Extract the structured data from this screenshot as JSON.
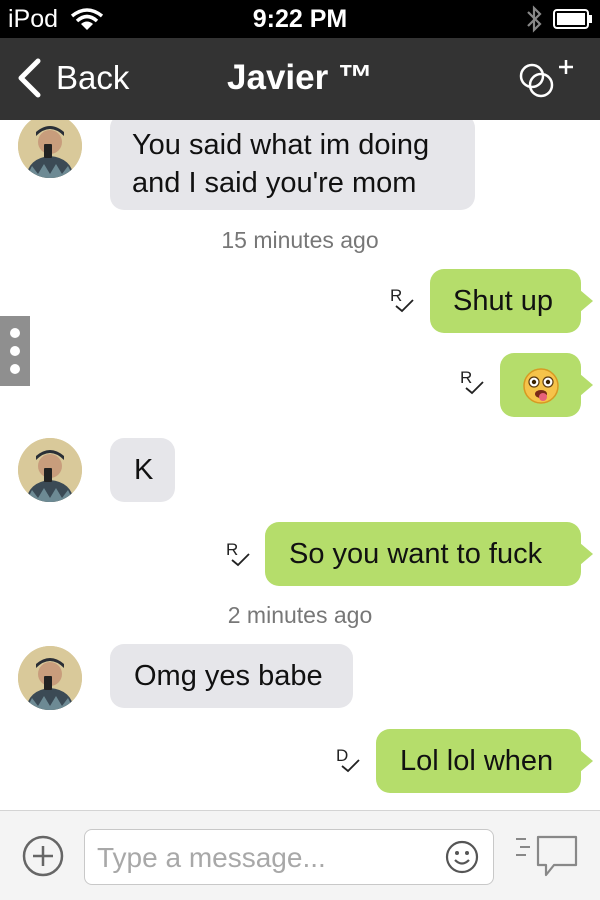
{
  "status_bar": {
    "carrier": "iPod",
    "time": "9:22 PM"
  },
  "nav": {
    "back_label": "Back",
    "title": "Javier ™"
  },
  "messages": [
    {
      "from": "contact",
      "text_lines": [
        "You said what im doing",
        "and I said you're mom"
      ]
    },
    {
      "timestamp": "15 minutes ago"
    },
    {
      "from": "me",
      "text": "Shut up",
      "receipt": "R"
    },
    {
      "from": "me",
      "emoji": "astonished-tongue-emoji",
      "receipt": "R"
    },
    {
      "from": "contact",
      "text": "K"
    },
    {
      "from": "me",
      "text": "So you want to fuck",
      "receipt": "R"
    },
    {
      "timestamp": "2 minutes ago"
    },
    {
      "from": "contact",
      "text": "Omg yes babe"
    },
    {
      "from": "me",
      "text": "Lol lol when",
      "receipt": "D"
    }
  ],
  "compose": {
    "placeholder": "Type a message...",
    "value": ""
  },
  "colors": {
    "status_bar": "#000000",
    "nav_bar": "#333333",
    "outgoing_bubble": "#b5dd6b",
    "incoming_bubble": "#e6e6ea",
    "timestamp_text": "#777777"
  },
  "icons": [
    "wifi-icon",
    "bluetooth-icon",
    "battery-icon",
    "back-chevron-icon",
    "add-people-icon",
    "plus-circle-icon",
    "smiley-icon",
    "chat-send-icon",
    "check-icon"
  ]
}
